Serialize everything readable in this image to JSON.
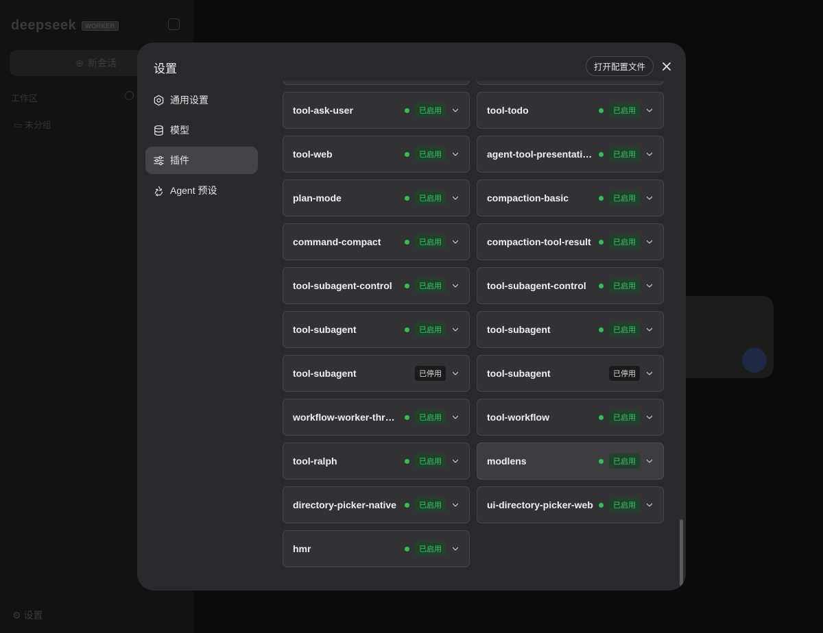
{
  "background": {
    "logo_text": "deepseek",
    "logo_badge": "WORKER",
    "new_chat_label": "新会话",
    "workspace_label": "工作区",
    "folder_label": "未分组",
    "settings_label": "设置"
  },
  "modal": {
    "title": "设置",
    "open_config_label": "打开配置文件",
    "nav": [
      {
        "label": "通用设置",
        "icon": "gear-icon"
      },
      {
        "label": "模型",
        "icon": "database-icon"
      },
      {
        "label": "插件",
        "icon": "sliders-icon",
        "active": true
      },
      {
        "label": "Agent 预设",
        "icon": "recycle-icon"
      }
    ],
    "plugins": [
      {
        "name": "",
        "status": "on"
      },
      {
        "name": "",
        "status": "on"
      },
      {
        "name": "tool-ask-user",
        "status": "on"
      },
      {
        "name": "tool-todo",
        "status": "on"
      },
      {
        "name": "tool-web",
        "status": "on"
      },
      {
        "name": "agent-tool-presentation",
        "status": "on"
      },
      {
        "name": "plan-mode",
        "status": "on"
      },
      {
        "name": "compaction-basic",
        "status": "on"
      },
      {
        "name": "command-compact",
        "status": "on"
      },
      {
        "name": "compaction-tool-result",
        "status": "on"
      },
      {
        "name": "tool-subagent-control",
        "status": "on"
      },
      {
        "name": "tool-subagent-control",
        "status": "on"
      },
      {
        "name": "tool-subagent",
        "status": "on"
      },
      {
        "name": "tool-subagent",
        "status": "on"
      },
      {
        "name": "tool-subagent",
        "status": "off"
      },
      {
        "name": "tool-subagent",
        "status": "off"
      },
      {
        "name": "workflow-worker-thread",
        "status": "on"
      },
      {
        "name": "tool-workflow",
        "status": "on"
      },
      {
        "name": "tool-ralph",
        "status": "on"
      },
      {
        "name": "modlens",
        "status": "on",
        "hover": true
      },
      {
        "name": "directory-picker-native",
        "status": "on"
      },
      {
        "name": "ui-directory-picker-web",
        "status": "on"
      },
      {
        "name": "hmr",
        "status": "on"
      }
    ],
    "status_labels": {
      "on": "已启用",
      "off": "已停用"
    }
  }
}
